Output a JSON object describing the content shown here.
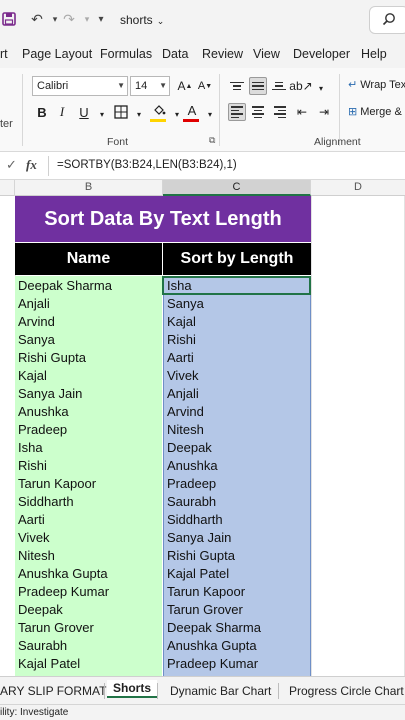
{
  "titlebar": {
    "doc_name": "shorts",
    "undo_caret": "▾",
    "redo_caret": "▾",
    "qat_caret": "▾",
    "doc_caret": "⌄"
  },
  "ribbon_tabs": [
    "rt",
    "Page Layout",
    "Formulas",
    "Data",
    "Review",
    "View",
    "Developer",
    "Help"
  ],
  "ribbon": {
    "clipboard_partial_label": "ter",
    "font_name": "Calibri",
    "font_size": "14",
    "font_group_label": "Font",
    "alignment_group_label": "Alignment",
    "wrap_text_label": "Wrap Tex",
    "merge_label": "Merge &",
    "bold": "B",
    "italic": "I",
    "underline": "U",
    "font_color_letter": "A"
  },
  "formula_bar": {
    "fx": "fx",
    "formula": "=SORTBY(B3:B24,LEN(B3:B24),1)"
  },
  "columns": [
    "B",
    "C",
    "D"
  ],
  "sheet": {
    "title": "Sort Data By Text Length",
    "header_name": "Name",
    "header_sorted": "Sort by Length",
    "names": [
      "Deepak Sharma",
      "Anjali",
      "Arvind",
      "Sanya",
      "Rishi Gupta",
      "Kajal",
      "Sanya Jain",
      "Anushka",
      "Pradeep",
      "Isha",
      "Rishi",
      "Tarun Kapoor",
      "Siddharth",
      "Aarti",
      "Vivek",
      "Nitesh",
      "Anushka Gupta",
      "Pradeep Kumar",
      "Deepak",
      "Tarun Grover",
      "Saurabh",
      "Kajal Patel"
    ],
    "sorted": [
      "Isha",
      "Sanya",
      "Kajal",
      "Rishi",
      "Aarti",
      "Vivek",
      "Anjali",
      "Arvind",
      "Nitesh",
      "Deepak",
      "Anushka",
      "Pradeep",
      "Saurabh",
      "Siddharth",
      "Sanya Jain",
      "Rishi Gupta",
      "Kajal Patel",
      "Tarun Kapoor",
      "Tarun Grover",
      "Deepak Sharma",
      "Anushka Gupta",
      "Pradeep Kumar"
    ]
  },
  "sheet_tabs": [
    "ARY SLIP FORMAT",
    "Shorts",
    "Dynamic Bar Chart",
    "Progress Circle Chart"
  ],
  "status": {
    "text": "ility: Investigate"
  },
  "colors": {
    "title_bg": "#7030a0",
    "header_bg": "#000000",
    "names_bg": "#ccffcc",
    "sorted_bg": "#b4c7e7",
    "accent": "#217346"
  }
}
